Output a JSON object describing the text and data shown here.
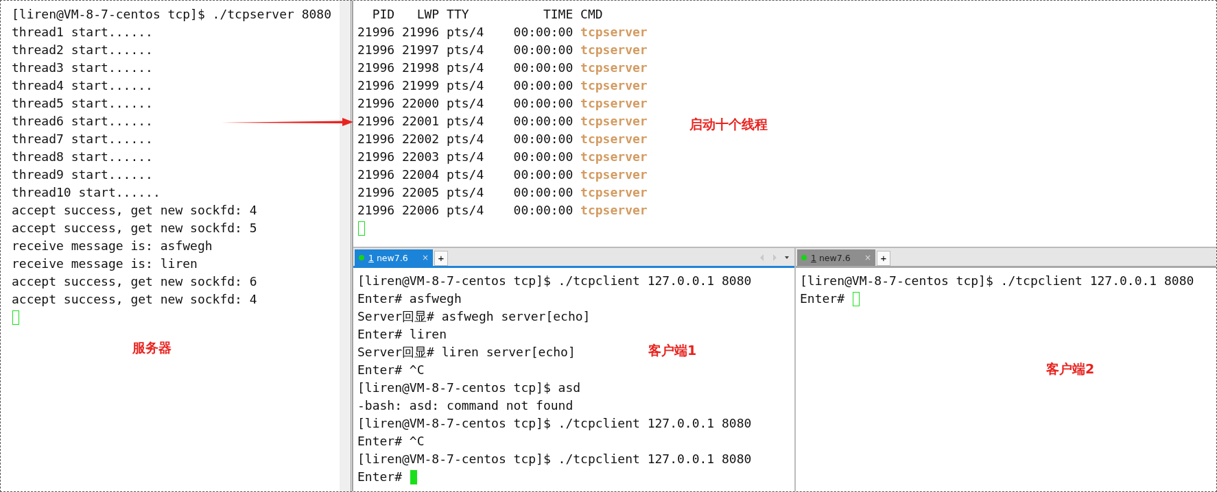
{
  "server_terminal": {
    "lines": [
      {
        "text": "[liren@VM-8-7-centos tcp]$ ./tcpserver 8080"
      },
      {
        "text": "thread1 start......"
      },
      {
        "text": "thread2 start......"
      },
      {
        "text": "thread3 start......"
      },
      {
        "text": "thread4 start......"
      },
      {
        "text": "thread5 start......"
      },
      {
        "text": "thread6 start......"
      },
      {
        "text": "thread7 start......"
      },
      {
        "text": "thread8 start......"
      },
      {
        "text": "thread9 start......"
      },
      {
        "text": "thread10 start......"
      },
      {
        "text": "accept success, get new sockfd: 4"
      },
      {
        "text": "accept success, get new sockfd: 5"
      },
      {
        "text": "receive message is: asfwegh"
      },
      {
        "text": "receive message is: liren"
      },
      {
        "text": "accept success, get new sockfd: 6"
      },
      {
        "text": "accept success, get new sockfd: 4"
      }
    ],
    "cursor_filled": false
  },
  "ps_terminal": {
    "header": "  PID   LWP TTY          TIME CMD",
    "rows": [
      {
        "fields": "21996 21996 pts/4    00:00:00 ",
        "cmd": "tcpserver"
      },
      {
        "fields": "21996 21997 pts/4    00:00:00 ",
        "cmd": "tcpserver"
      },
      {
        "fields": "21996 21998 pts/4    00:00:00 ",
        "cmd": "tcpserver"
      },
      {
        "fields": "21996 21999 pts/4    00:00:00 ",
        "cmd": "tcpserver"
      },
      {
        "fields": "21996 22000 pts/4    00:00:00 ",
        "cmd": "tcpserver"
      },
      {
        "fields": "21996 22001 pts/4    00:00:00 ",
        "cmd": "tcpserver"
      },
      {
        "fields": "21996 22002 pts/4    00:00:00 ",
        "cmd": "tcpserver"
      },
      {
        "fields": "21996 22003 pts/4    00:00:00 ",
        "cmd": "tcpserver"
      },
      {
        "fields": "21996 22004 pts/4    00:00:00 ",
        "cmd": "tcpserver"
      },
      {
        "fields": "21996 22005 pts/4    00:00:00 ",
        "cmd": "tcpserver"
      },
      {
        "fields": "21996 22006 pts/4    00:00:00 ",
        "cmd": "tcpserver"
      }
    ],
    "cursor_filled": false
  },
  "client_panes": [
    {
      "tab": {
        "number": "1",
        "title": " new7.6",
        "close": "×",
        "selected": true
      },
      "add_tab": "+",
      "lines": [
        {
          "text": "[liren@VM-8-7-centos tcp]$ ./tcpclient 127.0.0.1 8080"
        },
        {
          "text": "Enter# asfwegh"
        },
        {
          "text": "Server回显# asfwegh server[echo]"
        },
        {
          "text": "Enter# liren"
        },
        {
          "text": "Server回显# liren server[echo]"
        },
        {
          "text": "Enter# ^C"
        },
        {
          "text": "[liren@VM-8-7-centos tcp]$ asd"
        },
        {
          "text": "-bash: asd: command not found"
        },
        {
          "text": "[liren@VM-8-7-centos tcp]$ ./tcpclient 127.0.0.1 8080"
        },
        {
          "text": "Enter# ^C"
        },
        {
          "text": "[liren@VM-8-7-centos tcp]$ ./tcpclient 127.0.0.1 8080"
        },
        {
          "text": "Enter# "
        }
      ],
      "cursor_filled": true
    },
    {
      "tab": {
        "number": "1",
        "title": " new7.6",
        "close": "×",
        "selected": false
      },
      "add_tab": "+",
      "lines": [
        {
          "text": "[liren@VM-8-7-centos tcp]$ ./tcpclient 127.0.0.1 8080"
        },
        {
          "text": "Enter# "
        }
      ],
      "cursor_filled": false
    }
  ],
  "annotations": [
    {
      "kind": "label",
      "text": "服务器"
    },
    {
      "kind": "label",
      "text": "客户端1"
    },
    {
      "kind": "label",
      "text": "客户端2"
    },
    {
      "kind": "label",
      "text": "启动十个线程"
    },
    {
      "kind": "arrow"
    }
  ]
}
